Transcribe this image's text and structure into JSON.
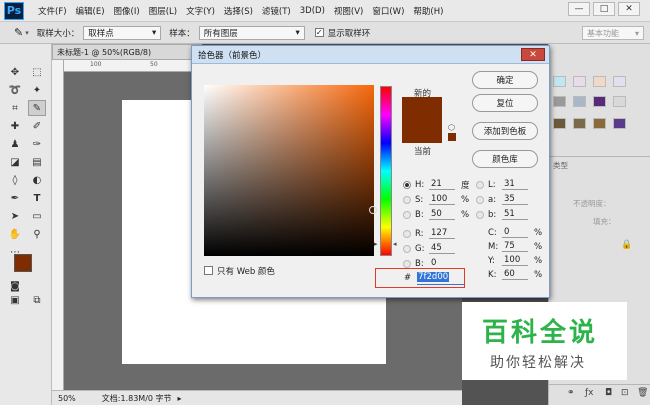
{
  "app": {
    "logo": "Ps"
  },
  "menu": [
    "文件(F)",
    "编辑(E)",
    "图像(I)",
    "图层(L)",
    "文字(Y)",
    "选择(S)",
    "滤镜(T)",
    "3D(D)",
    "视图(V)",
    "窗口(W)",
    "帮助(H)"
  ],
  "window_controls": {
    "minimize": "—",
    "maximize": "□",
    "close": "✕"
  },
  "options_bar": {
    "sample_size_label": "取样大小：",
    "sample_size_value": "取样点",
    "sample_label": "样本：",
    "sample_value": "所有图层",
    "show_ring_label": "显示取样环",
    "workspace": "基本功能"
  },
  "document": {
    "tab_title": "未标题-1 @ 50%(RGB/8)",
    "ruler_marks": [
      "100",
      "50"
    ],
    "status_zoom": "50%",
    "status_info": "文档:1.83M/0 字节"
  },
  "colors": {
    "foreground": "#7f2d00",
    "background": "#ffffff",
    "current_swatch": "#7f2d00",
    "new_swatch": "#7f2d00",
    "hex_highlight": "#3375d6",
    "watermark_green": "#2eb34b"
  },
  "dialog": {
    "title": "拾色器（前景色）",
    "buttons": {
      "ok": "确定",
      "reset": "复位",
      "add_swatch": "添加到色板",
      "libraries": "颜色库"
    },
    "new_label": "新的",
    "current_label": "当前",
    "web_only_label": "只有 Web 颜色",
    "hex_prefix": "#",
    "hex_value": "7f2d00",
    "hsb": {
      "h": {
        "label": "H:",
        "value": "21",
        "unit": "度"
      },
      "s": {
        "label": "S:",
        "value": "100",
        "unit": "%"
      },
      "b": {
        "label": "B:",
        "value": "50",
        "unit": "%"
      }
    },
    "rgb": {
      "r": {
        "label": "R:",
        "value": "127"
      },
      "g": {
        "label": "G:",
        "value": "45"
      },
      "b": {
        "label": "B:",
        "value": "0"
      }
    },
    "lab": {
      "l": {
        "label": "L:",
        "value": "31"
      },
      "a": {
        "label": "a:",
        "value": "35"
      },
      "b": {
        "label": "b:",
        "value": "51"
      }
    },
    "cmyk": {
      "c": {
        "label": "C:",
        "value": "0",
        "unit": "%"
      },
      "m": {
        "label": "M:",
        "value": "75",
        "unit": "%"
      },
      "y": {
        "label": "Y:",
        "value": "100",
        "unit": "%"
      },
      "k": {
        "label": "K:",
        "value": "60",
        "unit": "%"
      }
    }
  },
  "layers_panel": {
    "opacity_label": "不透明度：",
    "fill_label": "填充：",
    "kind_label": "类型",
    "lock_icon": "lock-icon"
  },
  "watermark": {
    "title": "百科全说",
    "subtitle": "助你轻松解决"
  }
}
